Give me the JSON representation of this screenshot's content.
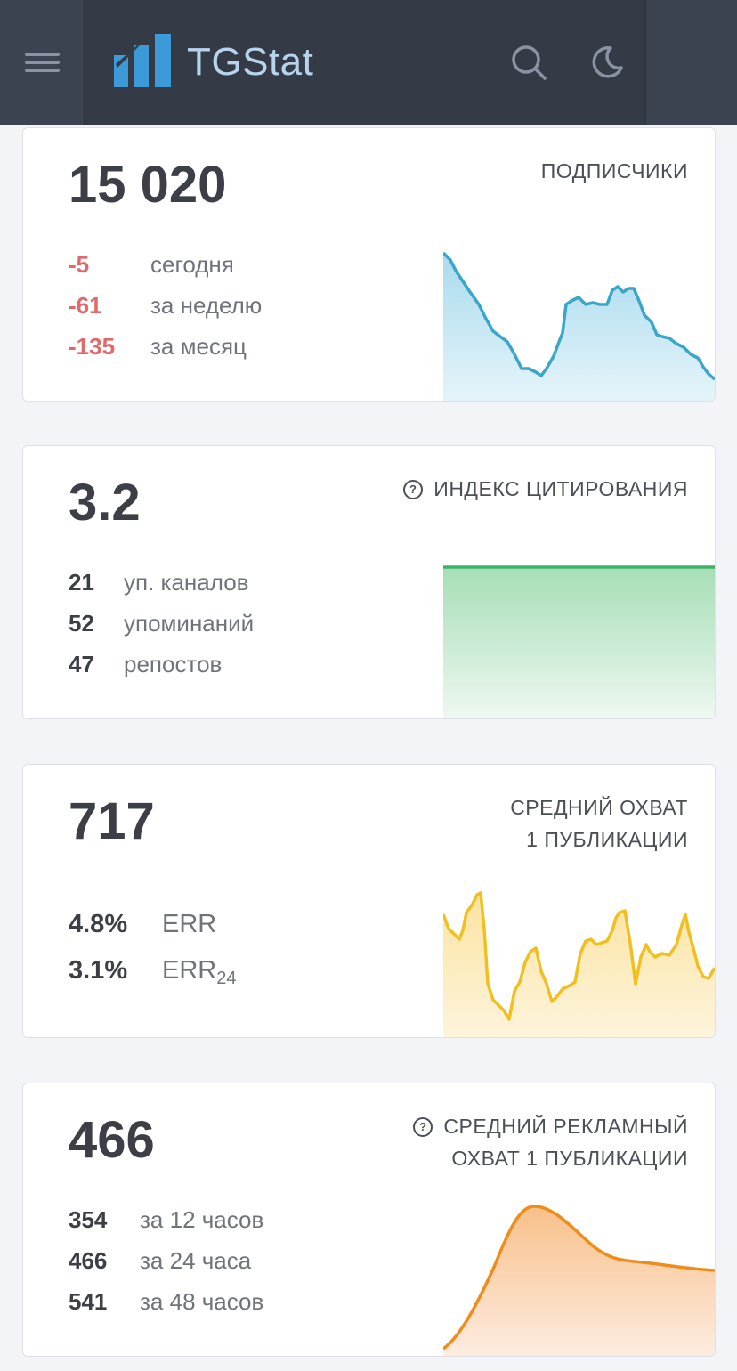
{
  "header": {
    "app_name": "TGStat",
    "icons": [
      "menu-icon",
      "logo-icon",
      "search-icon",
      "moon-icon"
    ]
  },
  "subscribers": {
    "value": "15 020",
    "title": "ПОДПИСЧИКИ",
    "rows": [
      {
        "num": "-5",
        "label": "сегодня"
      },
      {
        "num": "-61",
        "label": "за неделю"
      },
      {
        "num": "-135",
        "label": "за месяц"
      }
    ],
    "colors": {
      "line": "#3aa7c9",
      "negative": "#e06a6a"
    }
  },
  "citation": {
    "value": "3.2",
    "title": "ИНДЕКС ЦИТИРОВАНИЯ",
    "rows": [
      {
        "num": "21",
        "label": "уп. каналов"
      },
      {
        "num": "52",
        "label": "упоминаний"
      },
      {
        "num": "47",
        "label": "репостов"
      }
    ],
    "colors": {
      "line": "#3fb26a"
    }
  },
  "reach": {
    "value": "717",
    "title_line1": "СРЕДНИЙ ОХВАТ",
    "title_line2": "1 ПУБЛИКАЦИИ",
    "rows": [
      {
        "num": "4.8%",
        "label": "ERR",
        "sub": ""
      },
      {
        "num": "3.1%",
        "label": "ERR",
        "sub": "24"
      }
    ],
    "colors": {
      "line": "#f0c020"
    }
  },
  "ad_reach": {
    "value": "466",
    "title_line1": "СРЕДНИЙ РЕКЛАМНЫЙ",
    "title_line2": "ОХВАТ 1 ПУБЛИКАЦИИ",
    "rows": [
      {
        "num": "354",
        "label": "за 12 часов"
      },
      {
        "num": "466",
        "label": "за 24 часа"
      },
      {
        "num": "541",
        "label": "за 48 часов"
      }
    ],
    "colors": {
      "line": "#ef8c1a"
    }
  }
}
